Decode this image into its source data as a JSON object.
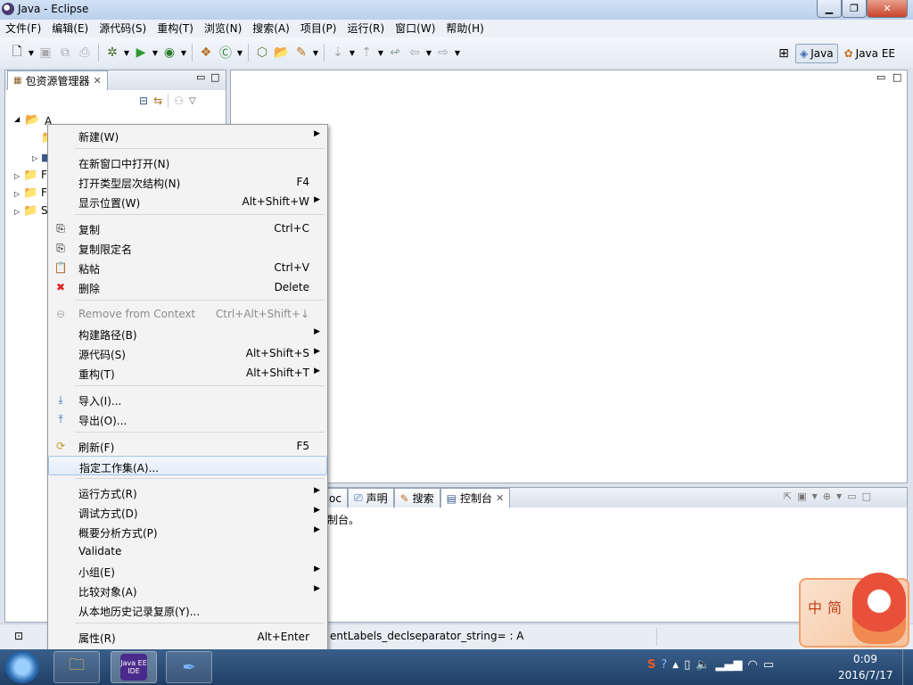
{
  "window": {
    "title": "Java  - Eclipse",
    "icon": "eclipse-icon"
  },
  "menubar": [
    "文件(F)",
    "编辑(E)",
    "源代码(S)",
    "重构(T)",
    "浏览(N)",
    "搜索(A)",
    "项目(P)",
    "运行(R)",
    "窗口(W)",
    "帮助(H)"
  ],
  "perspectives": {
    "java": "Java",
    "javaee": "Java EE"
  },
  "explorer": {
    "tab": "包资源管理器",
    "tree": [
      {
        "label": "A",
        "icon": "project-icon"
      },
      {
        "label": "",
        "icon": "folder-icon"
      },
      {
        "label": "",
        "icon": "package-icon"
      },
      {
        "label": "F",
        "icon": "project-icon"
      },
      {
        "label": "F",
        "icon": "project-icon"
      },
      {
        "label": "S",
        "icon": "project-icon"
      }
    ]
  },
  "bottom": {
    "tabs": [
      "oc",
      "声明",
      "搜索",
      "控制台"
    ],
    "console_text": "制台。",
    "status": "entLabels_declseparator_string= : A"
  },
  "context_menu": {
    "items": [
      {
        "label": "新建(W)",
        "shortcut": "",
        "submenu": true,
        "icon": "",
        "disabled": false
      },
      {
        "sep": true
      },
      {
        "label": "在新窗口中打开(N)",
        "shortcut": "",
        "submenu": false,
        "icon": "",
        "disabled": false
      },
      {
        "label": "打开类型层次结构(N)",
        "shortcut": "F4",
        "submenu": false,
        "icon": "",
        "disabled": false
      },
      {
        "label": "显示位置(W)",
        "shortcut": "Alt+Shift+W",
        "submenu": true,
        "icon": "",
        "disabled": false
      },
      {
        "sep": true
      },
      {
        "label": "复制",
        "shortcut": "Ctrl+C",
        "submenu": false,
        "icon": "copy-icon",
        "disabled": false
      },
      {
        "label": "复制限定名",
        "shortcut": "",
        "submenu": false,
        "icon": "copy-qualified-icon",
        "disabled": false
      },
      {
        "label": "粘帖",
        "shortcut": "Ctrl+V",
        "submenu": false,
        "icon": "paste-icon",
        "disabled": false
      },
      {
        "label": "删除",
        "shortcut": "Delete",
        "submenu": false,
        "icon": "delete-icon",
        "disabled": false
      },
      {
        "sep": true
      },
      {
        "label": "Remove from Context",
        "shortcut": "Ctrl+Alt+Shift+↓",
        "submenu": false,
        "icon": "remove-context-icon",
        "disabled": true
      },
      {
        "label": "构建路径(B)",
        "shortcut": "",
        "submenu": true,
        "icon": "",
        "disabled": false
      },
      {
        "label": "源代码(S)",
        "shortcut": "Alt+Shift+S",
        "submenu": true,
        "icon": "",
        "disabled": false
      },
      {
        "label": "重构(T)",
        "shortcut": "Alt+Shift+T",
        "submenu": true,
        "icon": "",
        "disabled": false
      },
      {
        "sep": true
      },
      {
        "label": "导入(I)...",
        "shortcut": "",
        "submenu": false,
        "icon": "import-icon",
        "disabled": false
      },
      {
        "label": "导出(O)...",
        "shortcut": "",
        "submenu": false,
        "icon": "export-icon",
        "disabled": false
      },
      {
        "sep": true
      },
      {
        "label": "刷新(F)",
        "shortcut": "F5",
        "submenu": false,
        "icon": "refresh-icon",
        "disabled": false
      },
      {
        "label": "指定工作集(A)...",
        "shortcut": "",
        "submenu": false,
        "icon": "",
        "disabled": false,
        "highlighted": true
      },
      {
        "sep": true
      },
      {
        "label": "运行方式(R)",
        "shortcut": "",
        "submenu": true,
        "icon": "",
        "disabled": false
      },
      {
        "label": "调试方式(D)",
        "shortcut": "",
        "submenu": true,
        "icon": "",
        "disabled": false
      },
      {
        "label": "概要分析方式(P)",
        "shortcut": "",
        "submenu": true,
        "icon": "",
        "disabled": false
      },
      {
        "label": "Validate",
        "shortcut": "",
        "submenu": false,
        "icon": "",
        "disabled": false
      },
      {
        "label": "小组(E)",
        "shortcut": "",
        "submenu": true,
        "icon": "",
        "disabled": false
      },
      {
        "label": "比较对象(A)",
        "shortcut": "",
        "submenu": true,
        "icon": "",
        "disabled": false
      },
      {
        "label": "从本地历史记录复原(Y)...",
        "shortcut": "",
        "submenu": false,
        "icon": "",
        "disabled": false
      },
      {
        "sep": true
      },
      {
        "label": "属性(R)",
        "shortcut": "Alt+Enter",
        "submenu": false,
        "icon": "",
        "disabled": false
      }
    ]
  },
  "ime": {
    "zh": "中",
    "simp": "简"
  },
  "taskbar": {
    "apps": [
      "explorer-app",
      "Java EE IDE",
      "feather-app"
    ],
    "java_ee_label": "Java EE IDE",
    "time": "0:09",
    "date": "2016/7/17"
  }
}
